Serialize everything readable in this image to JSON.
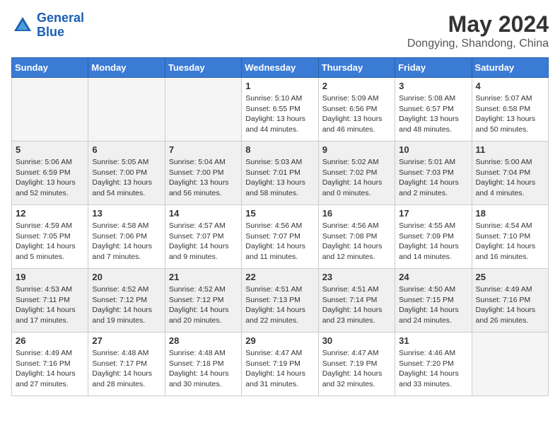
{
  "header": {
    "logo_line1": "General",
    "logo_line2": "Blue",
    "month": "May 2024",
    "location": "Dongying, Shandong, China"
  },
  "weekdays": [
    "Sunday",
    "Monday",
    "Tuesday",
    "Wednesday",
    "Thursday",
    "Friday",
    "Saturday"
  ],
  "weeks": [
    [
      {
        "day": "",
        "info": ""
      },
      {
        "day": "",
        "info": ""
      },
      {
        "day": "",
        "info": ""
      },
      {
        "day": "1",
        "info": "Sunrise: 5:10 AM\nSunset: 6:55 PM\nDaylight: 13 hours\nand 44 minutes."
      },
      {
        "day": "2",
        "info": "Sunrise: 5:09 AM\nSunset: 6:56 PM\nDaylight: 13 hours\nand 46 minutes."
      },
      {
        "day": "3",
        "info": "Sunrise: 5:08 AM\nSunset: 6:57 PM\nDaylight: 13 hours\nand 48 minutes."
      },
      {
        "day": "4",
        "info": "Sunrise: 5:07 AM\nSunset: 6:58 PM\nDaylight: 13 hours\nand 50 minutes."
      }
    ],
    [
      {
        "day": "5",
        "info": "Sunrise: 5:06 AM\nSunset: 6:59 PM\nDaylight: 13 hours\nand 52 minutes."
      },
      {
        "day": "6",
        "info": "Sunrise: 5:05 AM\nSunset: 7:00 PM\nDaylight: 13 hours\nand 54 minutes."
      },
      {
        "day": "7",
        "info": "Sunrise: 5:04 AM\nSunset: 7:00 PM\nDaylight: 13 hours\nand 56 minutes."
      },
      {
        "day": "8",
        "info": "Sunrise: 5:03 AM\nSunset: 7:01 PM\nDaylight: 13 hours\nand 58 minutes."
      },
      {
        "day": "9",
        "info": "Sunrise: 5:02 AM\nSunset: 7:02 PM\nDaylight: 14 hours\nand 0 minutes."
      },
      {
        "day": "10",
        "info": "Sunrise: 5:01 AM\nSunset: 7:03 PM\nDaylight: 14 hours\nand 2 minutes."
      },
      {
        "day": "11",
        "info": "Sunrise: 5:00 AM\nSunset: 7:04 PM\nDaylight: 14 hours\nand 4 minutes."
      }
    ],
    [
      {
        "day": "12",
        "info": "Sunrise: 4:59 AM\nSunset: 7:05 PM\nDaylight: 14 hours\nand 5 minutes."
      },
      {
        "day": "13",
        "info": "Sunrise: 4:58 AM\nSunset: 7:06 PM\nDaylight: 14 hours\nand 7 minutes."
      },
      {
        "day": "14",
        "info": "Sunrise: 4:57 AM\nSunset: 7:07 PM\nDaylight: 14 hours\nand 9 minutes."
      },
      {
        "day": "15",
        "info": "Sunrise: 4:56 AM\nSunset: 7:07 PM\nDaylight: 14 hours\nand 11 minutes."
      },
      {
        "day": "16",
        "info": "Sunrise: 4:56 AM\nSunset: 7:08 PM\nDaylight: 14 hours\nand 12 minutes."
      },
      {
        "day": "17",
        "info": "Sunrise: 4:55 AM\nSunset: 7:09 PM\nDaylight: 14 hours\nand 14 minutes."
      },
      {
        "day": "18",
        "info": "Sunrise: 4:54 AM\nSunset: 7:10 PM\nDaylight: 14 hours\nand 16 minutes."
      }
    ],
    [
      {
        "day": "19",
        "info": "Sunrise: 4:53 AM\nSunset: 7:11 PM\nDaylight: 14 hours\nand 17 minutes."
      },
      {
        "day": "20",
        "info": "Sunrise: 4:52 AM\nSunset: 7:12 PM\nDaylight: 14 hours\nand 19 minutes."
      },
      {
        "day": "21",
        "info": "Sunrise: 4:52 AM\nSunset: 7:12 PM\nDaylight: 14 hours\nand 20 minutes."
      },
      {
        "day": "22",
        "info": "Sunrise: 4:51 AM\nSunset: 7:13 PM\nDaylight: 14 hours\nand 22 minutes."
      },
      {
        "day": "23",
        "info": "Sunrise: 4:51 AM\nSunset: 7:14 PM\nDaylight: 14 hours\nand 23 minutes."
      },
      {
        "day": "24",
        "info": "Sunrise: 4:50 AM\nSunset: 7:15 PM\nDaylight: 14 hours\nand 24 minutes."
      },
      {
        "day": "25",
        "info": "Sunrise: 4:49 AM\nSunset: 7:16 PM\nDaylight: 14 hours\nand 26 minutes."
      }
    ],
    [
      {
        "day": "26",
        "info": "Sunrise: 4:49 AM\nSunset: 7:16 PM\nDaylight: 14 hours\nand 27 minutes."
      },
      {
        "day": "27",
        "info": "Sunrise: 4:48 AM\nSunset: 7:17 PM\nDaylight: 14 hours\nand 28 minutes."
      },
      {
        "day": "28",
        "info": "Sunrise: 4:48 AM\nSunset: 7:18 PM\nDaylight: 14 hours\nand 30 minutes."
      },
      {
        "day": "29",
        "info": "Sunrise: 4:47 AM\nSunset: 7:19 PM\nDaylight: 14 hours\nand 31 minutes."
      },
      {
        "day": "30",
        "info": "Sunrise: 4:47 AM\nSunset: 7:19 PM\nDaylight: 14 hours\nand 32 minutes."
      },
      {
        "day": "31",
        "info": "Sunrise: 4:46 AM\nSunset: 7:20 PM\nDaylight: 14 hours\nand 33 minutes."
      },
      {
        "day": "",
        "info": ""
      }
    ]
  ]
}
